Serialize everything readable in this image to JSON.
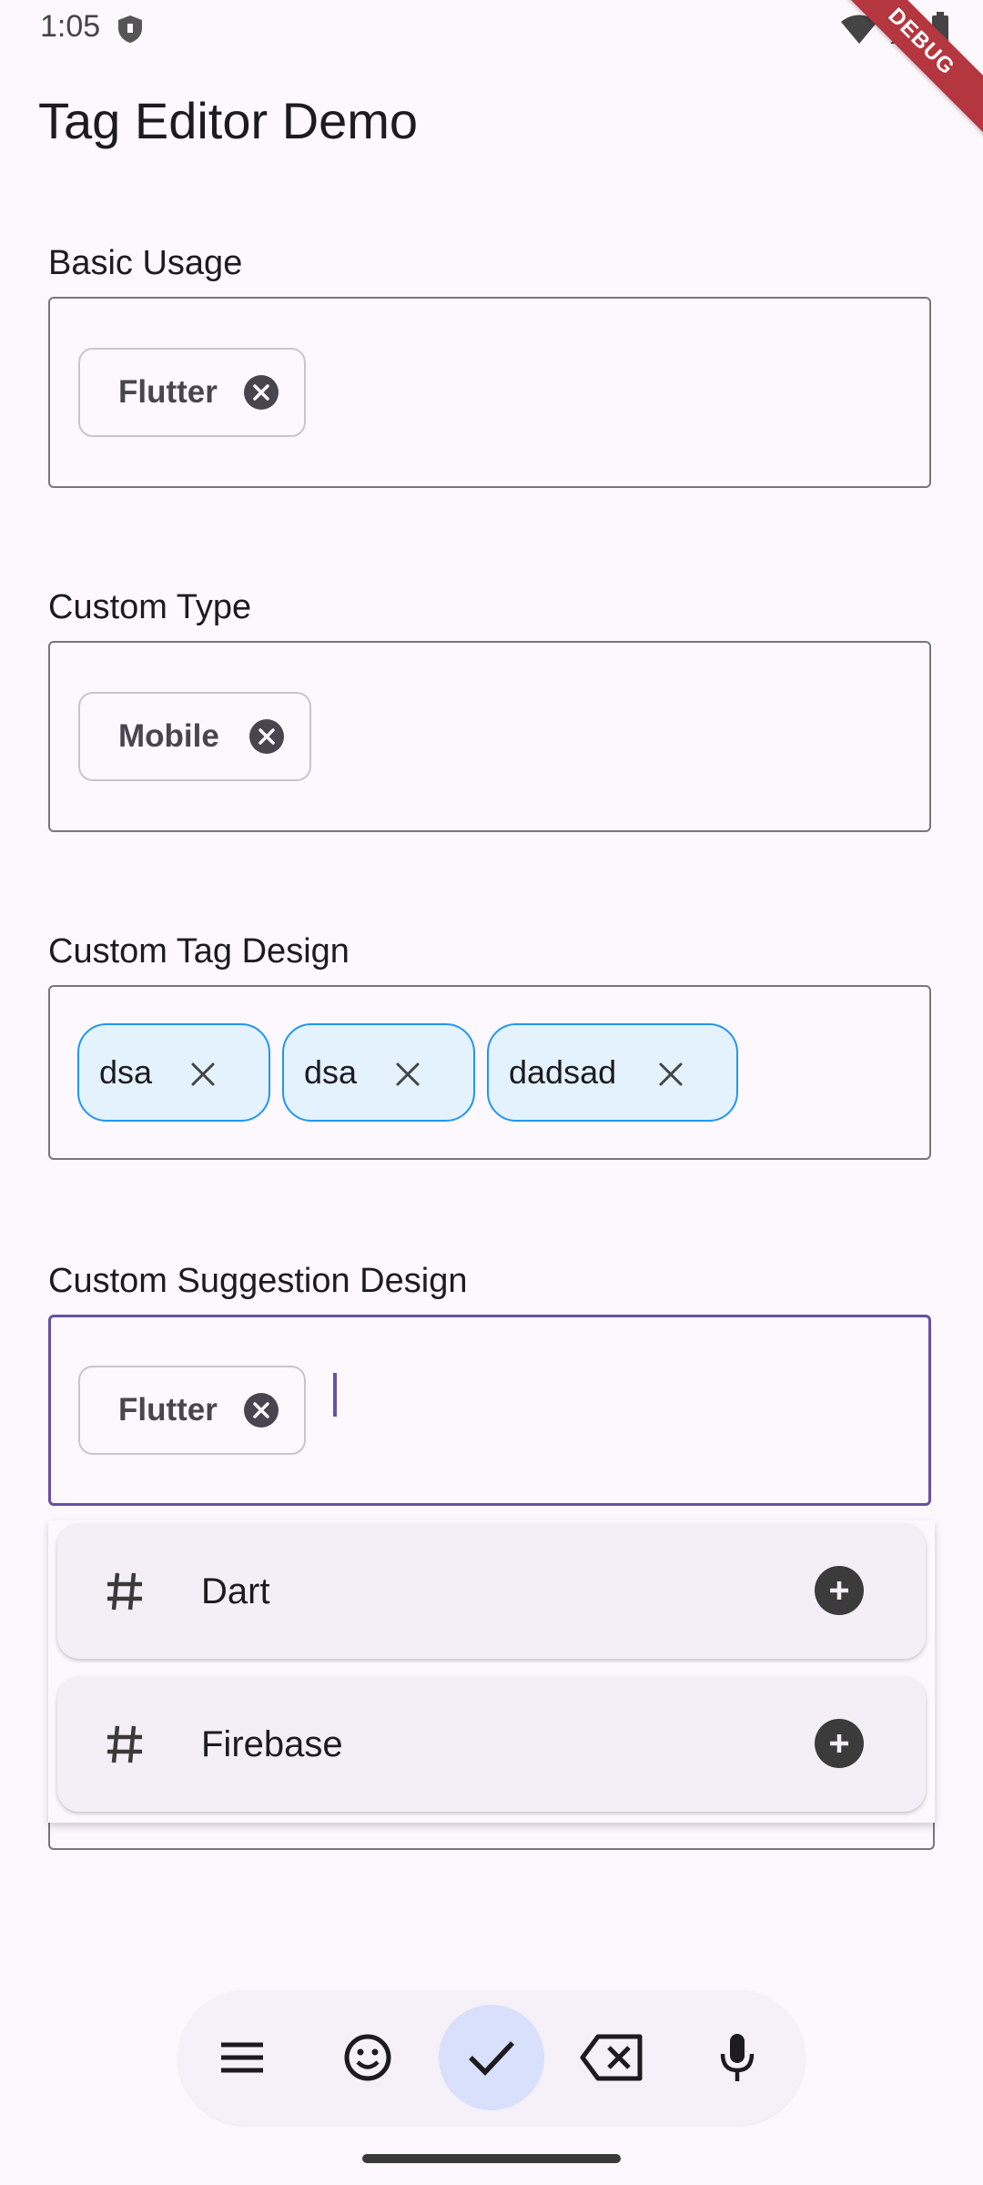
{
  "status_bar": {
    "time": "1:05"
  },
  "debug_banner": "DEBUG",
  "app": {
    "title": "Tag Editor Demo"
  },
  "sections": {
    "basic": {
      "label": "Basic Usage",
      "tags": [
        "Flutter"
      ]
    },
    "custom_type": {
      "label": "Custom Type",
      "tags": [
        "Mobile"
      ]
    },
    "custom_tag_design": {
      "label": "Custom Tag Design",
      "tags": [
        "dsa",
        "dsa",
        "dadsad"
      ]
    },
    "custom_suggestion_design": {
      "label": "Custom Suggestion Design",
      "tags": [
        "Flutter"
      ],
      "input_value": "",
      "suggestions": [
        "Dart",
        "Firebase"
      ]
    }
  },
  "keyboard_toolbar": {
    "buttons": [
      "menu-icon",
      "emoji-icon",
      "check-icon",
      "backspace-icon",
      "microphone-icon"
    ],
    "active": "check-icon"
  },
  "colors": {
    "background": "#fdf7fe",
    "focus_border": "#6750a4",
    "blue_chip_border": "#2196f3",
    "blue_chip_fill": "#e3f2fd",
    "debug_banner": "#b4363f"
  }
}
